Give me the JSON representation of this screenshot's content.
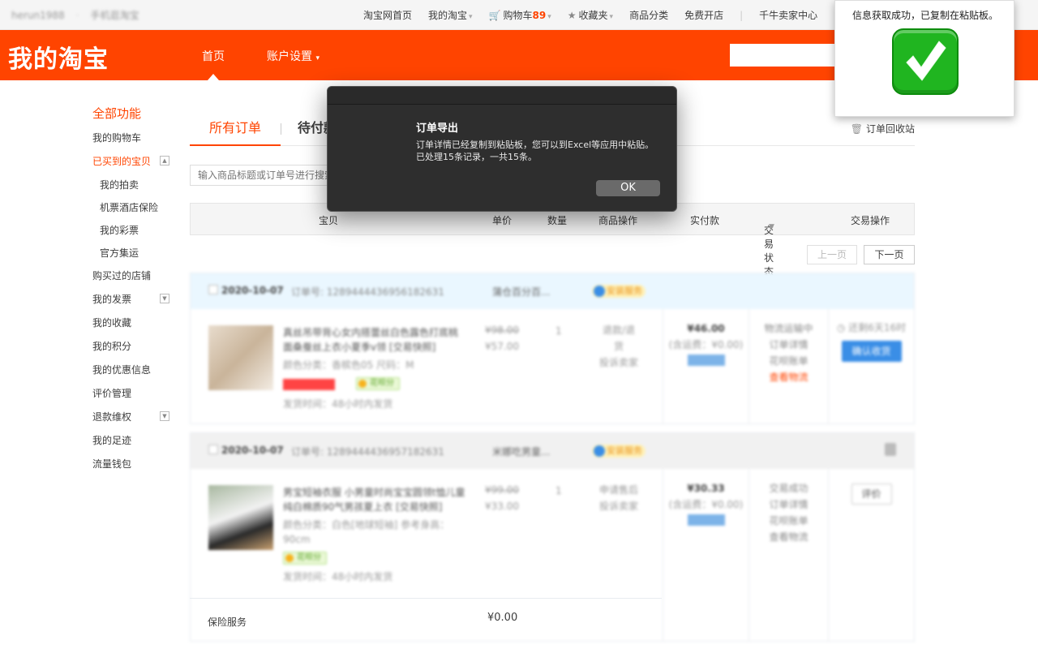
{
  "topbar": {
    "username": "herun1988",
    "mobile": "手机逛淘宝",
    "links": {
      "home": "淘宝网首页",
      "my_taobao": "我的淘宝",
      "cart": "购物车",
      "cart_count": "89",
      "favorites": "收藏夹",
      "categories": "商品分类",
      "open_shop": "免费开店",
      "seller_center": "千牛卖家中心"
    }
  },
  "header": {
    "logo": "我的淘宝",
    "nav_home": "首页",
    "nav_account": "账户设置",
    "brand_color": "#ff4400"
  },
  "sidebar": {
    "title": "全部功能",
    "items": [
      {
        "label": "我的购物车"
      },
      {
        "label": "已买到的宝贝"
      },
      {
        "label": "我的拍卖"
      },
      {
        "label": "机票酒店保险"
      },
      {
        "label": "我的彩票"
      },
      {
        "label": "官方集运"
      },
      {
        "label": "购买过的店铺"
      },
      {
        "label": "我的发票"
      },
      {
        "label": "我的收藏"
      },
      {
        "label": "我的积分"
      },
      {
        "label": "我的优惠信息"
      },
      {
        "label": "评价管理"
      },
      {
        "label": "退款维权"
      },
      {
        "label": "我的足迹"
      },
      {
        "label": "流量钱包"
      }
    ]
  },
  "main": {
    "tabs": {
      "all": "所有订单",
      "pending": "待付款"
    },
    "recycle": "订单回收站",
    "search_placeholder": "输入商品标题或订单号进行搜索",
    "columns": [
      "宝贝",
      "单价",
      "数量",
      "商品操作",
      "实付款",
      "交易状态",
      "交易操作"
    ],
    "pager": {
      "prev": "上一页",
      "next": "下一页"
    },
    "orders": [
      {
        "date": "2020-10-07",
        "order_no": "订单号: 1289444436956182631",
        "shop": "蒲仓百分百...",
        "badge": "安装服务",
        "title": "真丝吊带背心女内搭蕾丝白色露色打底桃面桑蚕丝上衣小夏季v领 [交易快照]",
        "attrs": "颜色分类：香槟色05  尺码：M",
        "shipping_time": "发货时间：48小时内发货",
        "price_orig": "¥98.00",
        "price": "¥57.00",
        "qty": "1",
        "ops": [
          "退款/退货",
          "投诉卖家"
        ],
        "pay": "¥46.00",
        "pay_ship": "(含运费：¥0.00)",
        "status": [
          "物流运输中",
          "订单详情",
          "花呗账单",
          "查看物流"
        ],
        "timer": "还剩6天16时",
        "action": "确认收货",
        "green_tag": "花呗分"
      },
      {
        "date": "2020-10-07",
        "order_no": "订单号: 1289444436957182631",
        "shop": "米娜吃男童...",
        "badge": "安装服务",
        "title": "男宝短袖衣服 小男童时尚宝宝圆领t恤儿童纯白棉质90气男孩夏上衣 [交易快照]",
        "attrs": "颜色分类：白色[地球短袖]  参考身高：90cm",
        "shipping_time": "发货时间：48小时内发货",
        "price_orig": "¥99.00",
        "price": "¥33.00",
        "qty": "1",
        "ops": [
          "申请售后",
          "投诉卖家"
        ],
        "pay": "¥30.33",
        "pay_ship": "(含运费：¥0.00)",
        "status": [
          "交易成功",
          "订单详情",
          "花呗账单",
          "查看物流"
        ],
        "action": "评价",
        "green_tag": "花呗分",
        "insurance_label": "保险服务",
        "insurance_value": "¥0.00"
      }
    ]
  },
  "modal": {
    "title": "订单导出",
    "message": "订单详情已经复制到粘贴板，您可以到Excel等应用中粘贴。已处理15条记录，一共15条。",
    "ok": "OK"
  },
  "toast": {
    "text": "信息获取成功，已复制在粘贴板。",
    "icon": "check-mark-icon"
  }
}
